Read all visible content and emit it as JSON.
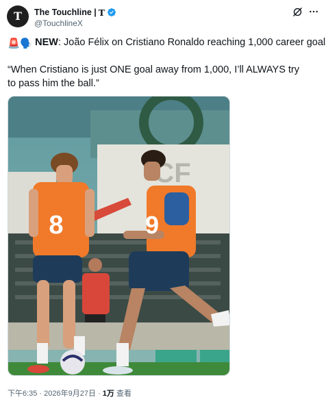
{
  "account": {
    "display_name": "The Touchline |",
    "name_badge": "T",
    "handle": "@TouchlineX",
    "avatar_letter": "T"
  },
  "tweet": {
    "emojis": [
      "🚨",
      "🗣️"
    ],
    "lead_bold": "NEW",
    "lead_rest": ": João Félix on Cristiano Ronaldo reaching 1,000 career goals:",
    "quote": "“When Cristiano is just ONE goal away from 1,000, I’ll ALWAYS try to pass him the ball.”"
  },
  "media": {
    "jersey_number_left": "8",
    "jersey_number_right": "9",
    "banner_text": "CF"
  },
  "meta": {
    "time_date": "下午6:35 · 2026年9月27日 · ",
    "views_count": "1万",
    "views_label": " 查看"
  },
  "colors": {
    "verified": "#1d9bf0",
    "text_primary": "#0f1419",
    "text_secondary": "#536471",
    "bib": "#f07a2a",
    "pitch": "#3f8a3a"
  },
  "icons": [
    "verified-badge-icon",
    "grok-icon",
    "more-options-icon",
    "siren-icon",
    "speaking-head-icon"
  ]
}
